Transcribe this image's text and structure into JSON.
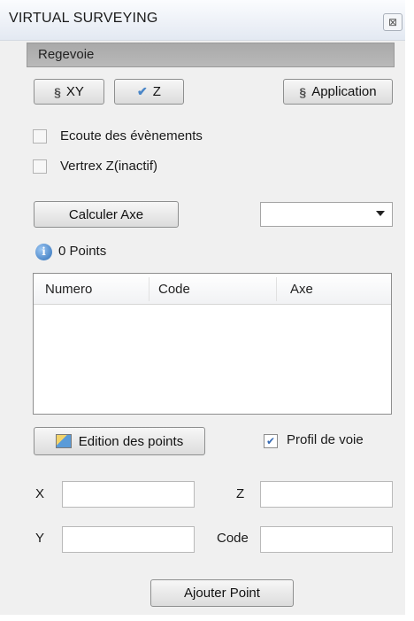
{
  "window": {
    "title": "VIRTUAL SURVEYING",
    "close_glyph": "⊠"
  },
  "section": {
    "title": "Regevoie"
  },
  "toolbar": {
    "xy_label": "XY",
    "z_label": "Z",
    "application_label": "Application",
    "swap_icon": "§",
    "check_icon": "✔"
  },
  "options": {
    "listen_events": {
      "label": "Ecoute des évènements",
      "checked": false
    },
    "vertex_z": {
      "label": "Vertrex Z(inactif)",
      "checked": false
    }
  },
  "axis": {
    "calc_label": "Calculer Axe",
    "selected": ""
  },
  "points": {
    "count_label": "0 Points",
    "info_icon": "i"
  },
  "table": {
    "columns": [
      "Numero",
      "Code",
      "Axe"
    ],
    "rows": []
  },
  "edit": {
    "label": "Edition des points"
  },
  "profile": {
    "label": "Profil de voie",
    "checked": true,
    "check_glyph": "✔"
  },
  "form": {
    "x_label": "X",
    "x_value": "",
    "z_label": "Z",
    "z_value": "",
    "y_label": "Y",
    "y_value": "",
    "code_label": "Code",
    "code_value": ""
  },
  "add_point": {
    "label": "Ajouter Point"
  }
}
